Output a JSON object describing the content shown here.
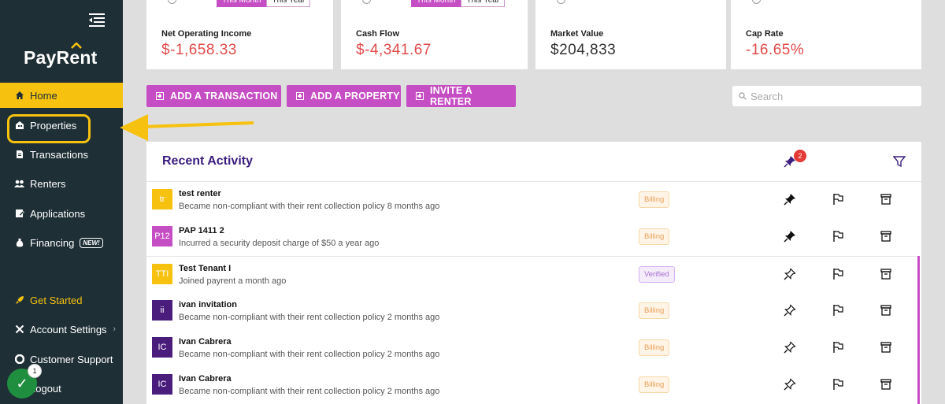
{
  "sidebar": {
    "logo": {
      "text_a": "PayR",
      "text_b": "e",
      "text_c": "nt"
    },
    "items": [
      {
        "label": "Home",
        "icon": "home-icon"
      },
      {
        "label": "Properties",
        "icon": "properties-icon"
      },
      {
        "label": "Transactions",
        "icon": "transactions-icon"
      },
      {
        "label": "Renters",
        "icon": "renters-icon"
      },
      {
        "label": "Applications",
        "icon": "applications-icon"
      },
      {
        "label": "Financing",
        "icon": "financing-icon",
        "badge": "NEW!"
      },
      {
        "label": "Get Started",
        "icon": "rocket-icon"
      },
      {
        "label": "Account Settings",
        "icon": "settings-icon"
      },
      {
        "label": "Customer Support",
        "icon": "support-icon"
      },
      {
        "label": "Logout",
        "icon": "logout-icon"
      }
    ],
    "notification_count": "1"
  },
  "stats": [
    {
      "label": "Net Operating Income",
      "value": "$-1,658.33",
      "tone": "neg"
    },
    {
      "label": "Cash Flow",
      "value": "$-4,341.67",
      "tone": "neg"
    },
    {
      "label": "Market Value",
      "value": "$204,833",
      "tone": "pos"
    },
    {
      "label": "Cap Rate",
      "value": "-16.65%",
      "tone": "neg"
    }
  ],
  "period_toggle": {
    "on": "This Month",
    "off": "This Year"
  },
  "actions": {
    "add_transaction": "ADD A TRANSACTION",
    "add_property": "ADD A PROPERTY",
    "invite_renter": "INVITE A RENTER"
  },
  "search": {
    "placeholder": "Search",
    "value": ""
  },
  "activity": {
    "title": "Recent Activity",
    "pinned_count": "2",
    "rows": [
      {
        "initials": "tr",
        "color": "#f6c10f",
        "name": "test renter",
        "desc": "Became non-compliant with their rent collection policy 8 months ago",
        "tag": "Billing",
        "pinned": true
      },
      {
        "initials": "P12",
        "color": "#c64ec4",
        "name": "PAP 1411 2",
        "desc": "Incurred a security deposit charge of $50 a year ago",
        "tag": "Billing",
        "pinned": true
      },
      {
        "initials": "TTI",
        "color": "#f6c10f",
        "name": "Test Tenant I",
        "desc": "Joined payrent a month ago",
        "tag": "Verified",
        "pinned": false
      },
      {
        "initials": "ii",
        "color": "#4a1d7d",
        "name": "ivan invitation",
        "desc": "Became non-compliant with their rent collection policy 2 months ago",
        "tag": "Billing",
        "pinned": false
      },
      {
        "initials": "IC",
        "color": "#4a1d7d",
        "name": "Ivan Cabrera",
        "desc": "Became non-compliant with their rent collection policy 2 months ago",
        "tag": "Billing",
        "pinned": false
      },
      {
        "initials": "IC",
        "color": "#4a1d7d",
        "name": "Ivan Cabrera",
        "desc": "Became non-compliant with their rent collection policy 2 months ago",
        "tag": "Billing",
        "pinned": false
      }
    ]
  },
  "colors": {
    "sidebar": "#1e2f36",
    "accent": "#f6c10f",
    "primary": "#c64ec4",
    "title": "#3a1d7d",
    "negative": "#e04a4a"
  }
}
